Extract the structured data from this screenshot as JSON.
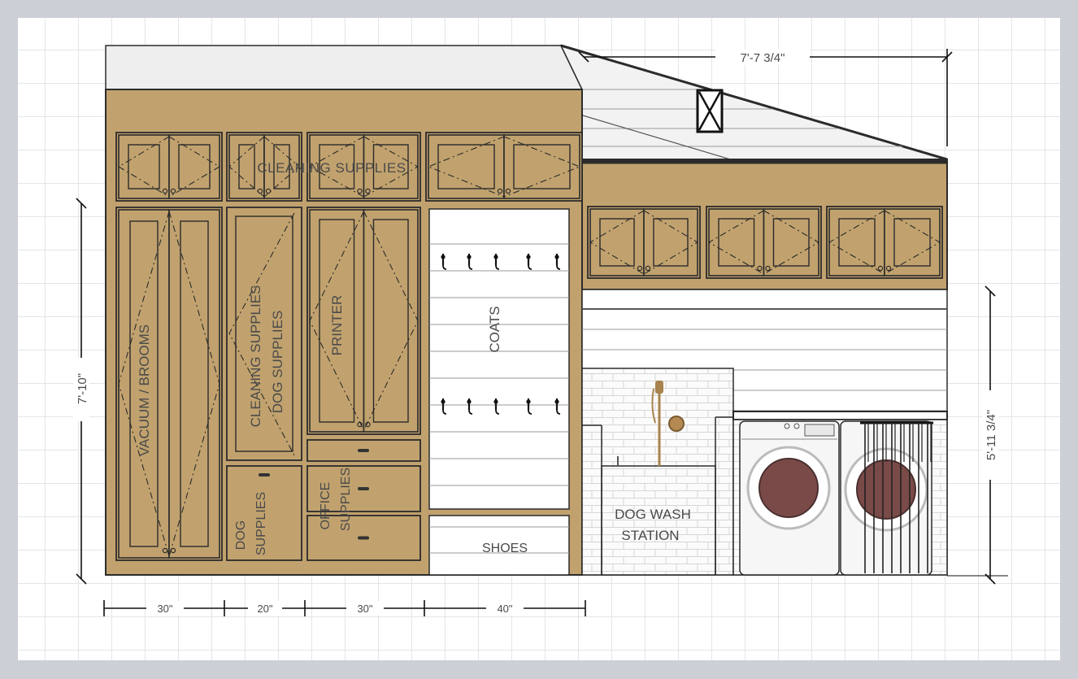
{
  "dimensions": {
    "top_width": "7'-7 3/4\"",
    "left_height": "7'-10\"",
    "right_height": "5'-11 3/4\"",
    "bottom_segments": [
      "30\"",
      "20\"",
      "30\"",
      "40\""
    ]
  },
  "labels": {
    "upper_cabinets": "CLEANING SUPPLIES",
    "tall_left": "VACUUM / BROOMS",
    "tall_second_a": "CLEANING SUPPLIES",
    "tall_second_b": "DOG SUPPLIES",
    "tall_third": "PRINTER",
    "bottom_second": [
      "DOG",
      "SUPPLIES"
    ],
    "bottom_third": [
      "OFFICE",
      "SUPPLIES"
    ],
    "coats": "COATS",
    "shoes": "SHOES",
    "dog_wash": [
      "DOG WASH",
      "STATION"
    ]
  },
  "colors": {
    "cabinet": "#c1a26e",
    "outline": "#2b2b2b",
    "background": "#ccd0d6",
    "grid": "#e3e5e9",
    "washer_window": "#7a4a48"
  }
}
